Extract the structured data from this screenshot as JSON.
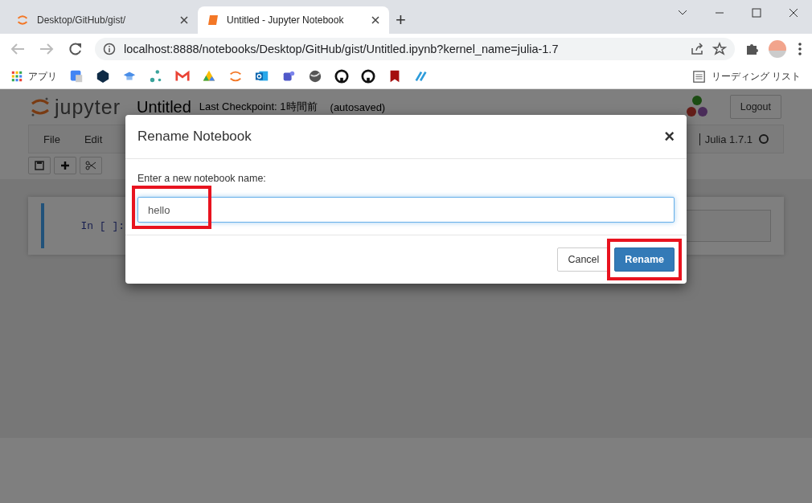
{
  "browser": {
    "tabs": [
      {
        "title": "Desktop/GitHub/gist/",
        "selected": false
      },
      {
        "title": "Untitled - Jupyter Notebook",
        "selected": true
      }
    ],
    "new_tab": "+",
    "url": "localhost:8888/notebooks/Desktop/GitHub/gist/Untitled.ipynb?kernel_name=julia-1.7",
    "bookmarks_apps": "アプリ",
    "reading_list": "リーディング リスト"
  },
  "notebook": {
    "logo_text": "jupyter",
    "title": "Untitled",
    "checkpoint": "Last Checkpoint: 1時間前",
    "autosave": "(autosaved)",
    "logout": "Logout",
    "menu": [
      "File",
      "Edit"
    ],
    "kernel": "Julia 1.7.1",
    "cell_prompt": "In [ ]:"
  },
  "dialog": {
    "title": "Rename Notebook",
    "close": "×",
    "prompt": "Enter a new notebook name:",
    "value": "hello",
    "value_highlighted": true,
    "buttons": [
      {
        "label": "Cancel",
        "kind": "default",
        "highlighted": false
      },
      {
        "label": "Rename",
        "kind": "primary",
        "highlighted": true
      }
    ]
  }
}
